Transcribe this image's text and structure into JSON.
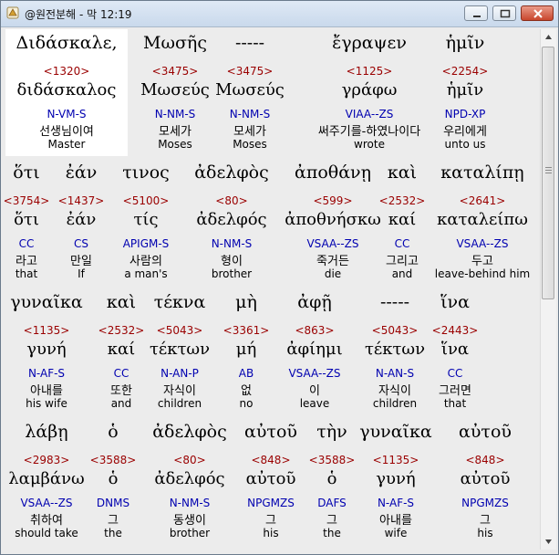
{
  "window": {
    "title": "@원전분해 - 막 12:19"
  },
  "rows": [
    [
      {
        "g": "Διδάσκαλε,",
        "s": "<1320>",
        "l": "διδάσκαλος",
        "p": "N-VM-S",
        "k": "선생님이여",
        "e": "Master"
      },
      {
        "g": "Μωσῆς",
        "s": "<3475>",
        "l": "Μωσεύς",
        "p": "N-NM-S",
        "k": "모세가",
        "e": "Moses"
      },
      {
        "g": "-----",
        "s": "<3475>",
        "l": "Μωσεύς",
        "p": "N-NM-S",
        "k": "모세가",
        "e": "Moses"
      },
      {
        "g": "ἔγραψεν",
        "s": "<1125>",
        "l": "γράφω",
        "p": "VIAA--ZS",
        "k": "써주기를-하였나이다",
        "e": "wrote"
      },
      {
        "g": "ἡμῖν",
        "s": "<2254>",
        "l": "ἡμῖν",
        "p": "NPD-XP",
        "k": "우리에게",
        "e": "unto us"
      }
    ],
    [
      {
        "g": "ὅτι",
        "s": "<3754>",
        "l": "ὅτι",
        "p": "CC",
        "k": "라고",
        "e": "that"
      },
      {
        "g": "ἐάν",
        "s": "<1437>",
        "l": "ἐάν",
        "p": "CS",
        "k": "만일",
        "e": "If"
      },
      {
        "g": "τινος",
        "s": "<5100>",
        "l": "τίς",
        "p": "APIGM-S",
        "k": "사람의",
        "e": "a man's"
      },
      {
        "g": "ἀδελφὸς",
        "s": "<80>",
        "l": "ἀδελφός",
        "p": "N-NM-S",
        "k": "형이",
        "e": "brother"
      },
      {
        "g": "ἀποθάνῃ",
        "s": "<599>",
        "l": "ἀποθνήσκω",
        "p": "VSAA--ZS",
        "k": "죽거든",
        "e": "die"
      },
      {
        "g": "καὶ",
        "s": "<2532>",
        "l": "καί",
        "p": "CC",
        "k": "그리고",
        "e": "and"
      },
      {
        "g": "καταλίπῃ",
        "s": "<2641>",
        "l": "καταλείπω",
        "p": "VSAA--ZS",
        "k": "두고",
        "e": "leave-behind him"
      }
    ],
    [
      {
        "g": "γυναῖκα",
        "s": "<1135>",
        "l": "γυνή",
        "p": "N-AF-S",
        "k": "아내를",
        "e": "his wife"
      },
      {
        "g": "καὶ",
        "s": "<2532>",
        "l": "καί",
        "p": "CC",
        "k": "또한",
        "e": "and"
      },
      {
        "g": "τέκνα",
        "s": "<5043>",
        "l": "τέκτων",
        "p": "N-AN-P",
        "k": "자식이",
        "e": "children"
      },
      {
        "g": "μὴ",
        "s": "<3361>",
        "l": "μή",
        "p": "AB",
        "k": "없",
        "e": "no"
      },
      {
        "g": "ἀφῇ",
        "s": "<863>",
        "l": "ἀφίημι",
        "p": "VSAA--ZS",
        "k": "이",
        "e": "leave"
      },
      {
        "g": "-----",
        "s": "<5043>",
        "l": "τέκτων",
        "p": "N-AN-S",
        "k": "자식이",
        "e": "children"
      },
      {
        "g": "ἵνα",
        "s": "<2443>",
        "l": "ἵνα",
        "p": "CC",
        "k": "그러면",
        "e": "that"
      }
    ],
    [
      {
        "g": "λάβῃ",
        "s": "<2983>",
        "l": "λαμβάνω",
        "p": "VSAA--ZS",
        "k": "취하여",
        "e": "should take"
      },
      {
        "g": "ὁ",
        "s": "<3588>",
        "l": "ὁ",
        "p": "DNMS",
        "k": "그",
        "e": "the"
      },
      {
        "g": "ἀδελφὸς",
        "s": "<80>",
        "l": "ἀδελφός",
        "p": "N-NM-S",
        "k": "동생이",
        "e": "brother"
      },
      {
        "g": "αὐτοῦ",
        "s": "<848>",
        "l": "αὐτοῦ",
        "p": "NPGMZS",
        "k": "그",
        "e": "his"
      },
      {
        "g": "τὴν",
        "s": "<3588>",
        "l": "ὁ",
        "p": "DAFS",
        "k": "그",
        "e": "the"
      },
      {
        "g": "γυναῖκα",
        "s": "<1135>",
        "l": "γυνή",
        "p": "N-AF-S",
        "k": "아내를",
        "e": "wife"
      },
      {
        "g": "αὐτοῦ",
        "s": "<848>",
        "l": "αὐτοῦ",
        "p": "NPGMZS",
        "k": "그",
        "e": "his"
      }
    ]
  ]
}
